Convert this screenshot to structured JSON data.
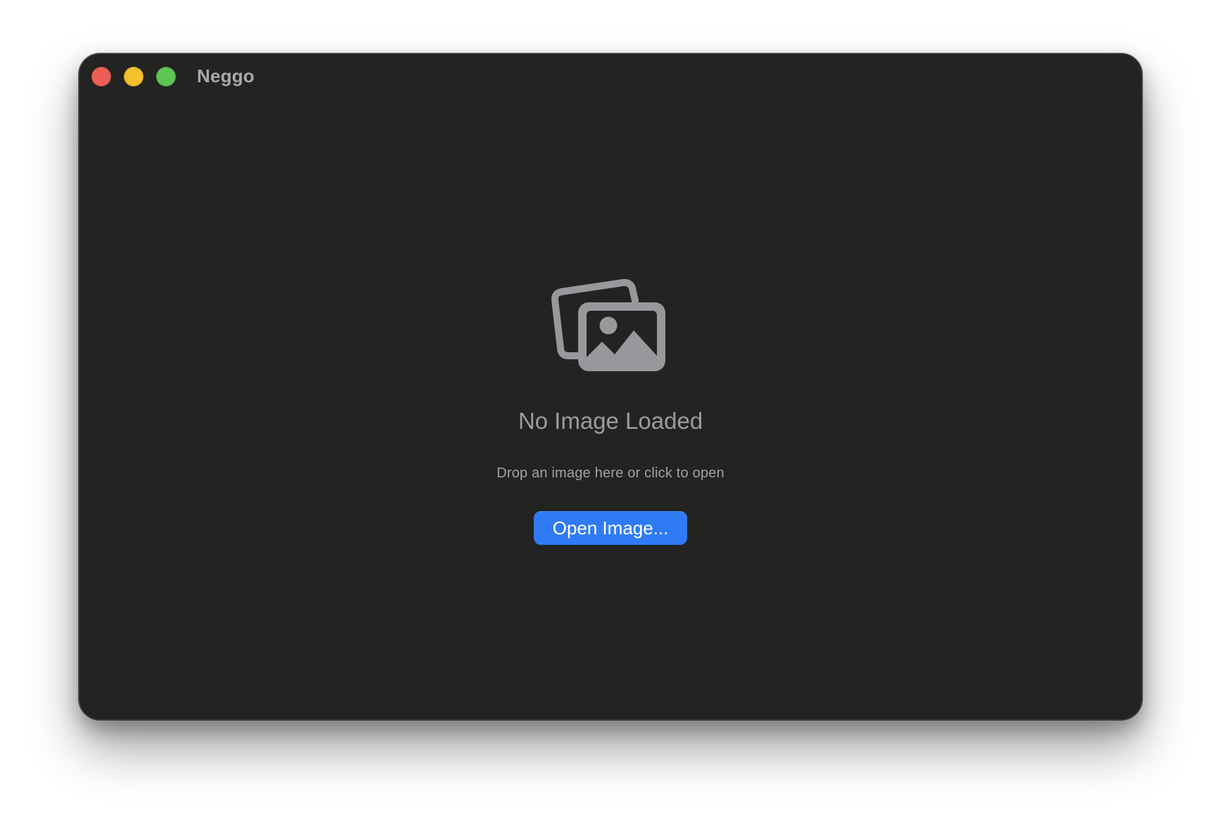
{
  "window": {
    "title": "Neggo"
  },
  "traffic_lights": {
    "close_color": "#ec5f57",
    "minimize_color": "#f4c02e",
    "zoom_color": "#5fc454"
  },
  "empty_state": {
    "icon": "photo-stack-icon",
    "icon_color": "#98989c",
    "title": "No Image Loaded",
    "hint": "Drop an image here or click to open"
  },
  "open_button": {
    "label": "Open Image...",
    "color": "#2f7bf6"
  }
}
